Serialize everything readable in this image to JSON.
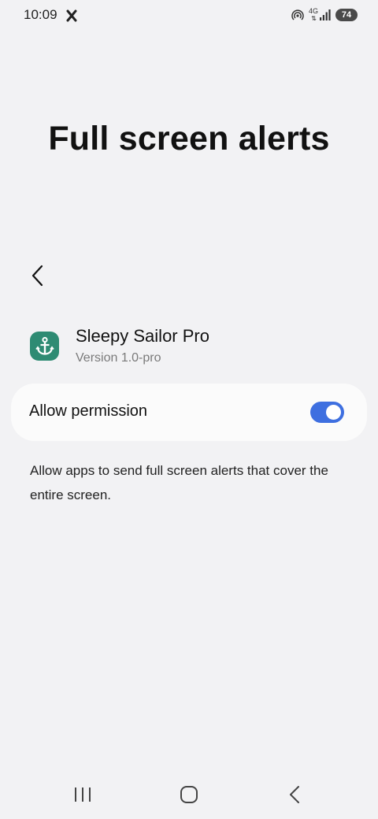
{
  "status_bar": {
    "time": "10:09",
    "network": "4G",
    "battery": "74",
    "icons": [
      "app-notification-icon",
      "hotspot-icon",
      "signal-icon",
      "battery-icon"
    ]
  },
  "page": {
    "title": "Full screen alerts"
  },
  "app": {
    "name": "Sleepy Sailor Pro",
    "version": "Version 1.0-pro",
    "icon": "anchor-icon",
    "icon_color": "#2e8b73"
  },
  "permission": {
    "label": "Allow permission",
    "enabled": true,
    "accent_color": "#3e6fe0"
  },
  "description": "Allow apps to send full screen alerts that cover the entire screen.",
  "nav_bar": {
    "icons": [
      "recent-apps-icon",
      "home-icon",
      "back-icon"
    ]
  }
}
